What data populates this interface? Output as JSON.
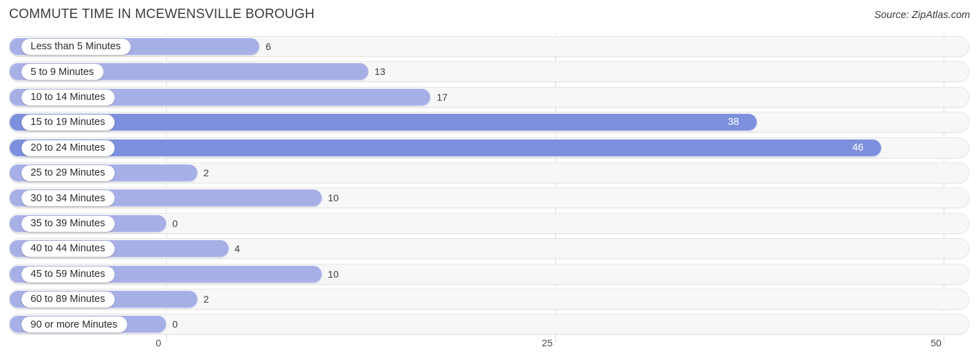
{
  "header": {
    "title": "COMMUTE TIME IN MCEWENSVILLE BOROUGH",
    "source": "Source: ZipAtlas.com"
  },
  "colors": {
    "bar_light": "#a7b0e6",
    "bar_dark": "#7d90dd",
    "track": "#f7f7f7",
    "gridline": "#dcdcdc",
    "text": "#3a3a3a",
    "value_inside": "#ffffff"
  },
  "chart_data": {
    "type": "bar",
    "orientation": "horizontal",
    "title": "COMMUTE TIME IN MCEWENSVILLE BOROUGH",
    "xlabel": "",
    "ylabel": "",
    "xlim": [
      0,
      50
    ],
    "grid": true,
    "legend": null,
    "xticks": [
      "0",
      "25",
      "50"
    ],
    "xtick_values": [
      0,
      25,
      50
    ],
    "categories": [
      "Less than 5 Minutes",
      "5 to 9 Minutes",
      "10 to 14 Minutes",
      "15 to 19 Minutes",
      "20 to 24 Minutes",
      "25 to 29 Minutes",
      "30 to 34 Minutes",
      "35 to 39 Minutes",
      "40 to 44 Minutes",
      "45 to 59 Minutes",
      "60 to 89 Minutes",
      "90 or more Minutes"
    ],
    "values": [
      6,
      13,
      17,
      38,
      46,
      2,
      10,
      0,
      4,
      10,
      2,
      0
    ],
    "value_labels": [
      "6",
      "13",
      "17",
      "38",
      "46",
      "2",
      "10",
      "0",
      "4",
      "10",
      "2",
      "0"
    ]
  }
}
